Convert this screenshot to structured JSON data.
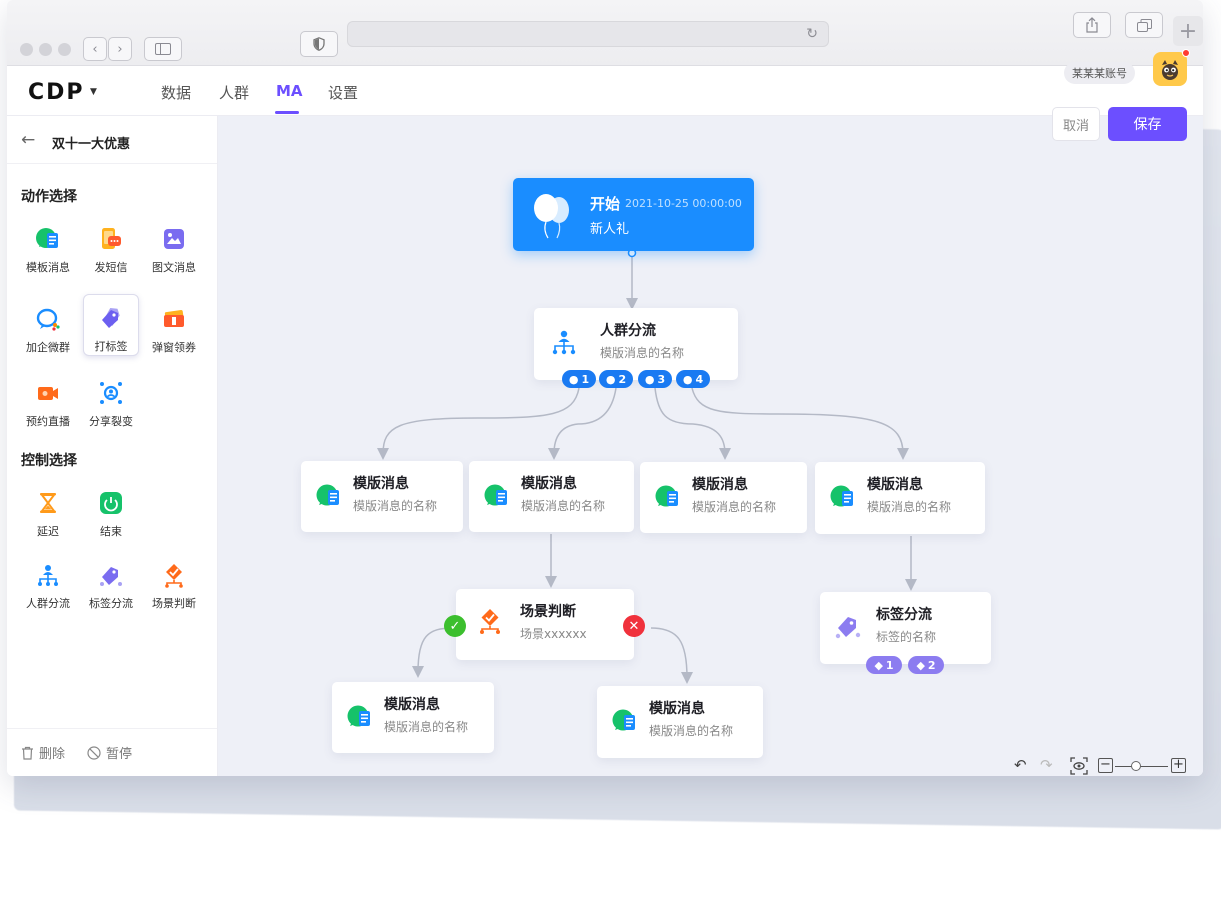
{
  "browser": {
    "url": ""
  },
  "header": {
    "logo": "CDP",
    "tabs": [
      {
        "label": "数据"
      },
      {
        "label": "人群"
      },
      {
        "label": "MA",
        "active": true
      },
      {
        "label": "设置"
      }
    ],
    "account": "某某某账号"
  },
  "actions": {
    "cancel": "取消",
    "save": "保存"
  },
  "sidebar": {
    "back_title": "双十一大优惠",
    "action_section": "动作选择",
    "action_tools": [
      {
        "label": "模板消息",
        "icon": "template-message-icon"
      },
      {
        "label": "发短信",
        "icon": "sms-icon"
      },
      {
        "label": "图文消息",
        "icon": "image-text-icon"
      },
      {
        "label": "加企微群",
        "icon": "wecom-group-icon"
      },
      {
        "label": "打标签",
        "icon": "tag-icon",
        "selected": true
      },
      {
        "label": "弹窗领券",
        "icon": "coupon-icon"
      },
      {
        "label": "预约直播",
        "icon": "live-icon"
      },
      {
        "label": "分享裂变",
        "icon": "share-fission-icon"
      }
    ],
    "control_section": "控制选择",
    "control_tools": [
      {
        "label": "延迟",
        "icon": "hourglass-icon"
      },
      {
        "label": "结束",
        "icon": "power-icon"
      },
      {
        "label": "人群分流",
        "icon": "crowd-split-icon"
      },
      {
        "label": "标签分流",
        "icon": "tag-split-icon"
      },
      {
        "label": "场景判断",
        "icon": "scene-judge-icon"
      }
    ],
    "footer": {
      "delete": "删除",
      "pause": "暂停"
    }
  },
  "flow": {
    "start": {
      "title": "开始",
      "time": "2021-10-25 00:00:00",
      "subtitle": "新人礼"
    },
    "crowd_split": {
      "title": "人群分流",
      "subtitle": "模版消息的名称",
      "branches": [
        "1",
        "2",
        "3",
        "4"
      ]
    },
    "messages": [
      {
        "title": "模版消息",
        "subtitle": "模版消息的名称"
      },
      {
        "title": "模版消息",
        "subtitle": "模版消息的名称"
      },
      {
        "title": "模版消息",
        "subtitle": "模版消息的名称"
      },
      {
        "title": "模版消息",
        "subtitle": "模版消息的名称"
      }
    ],
    "scene_judge": {
      "title": "场景判断",
      "subtitle": "场景xxxxxx"
    },
    "tag_split": {
      "title": "标签分流",
      "subtitle": "标签的名称",
      "branches": [
        "1",
        "2"
      ]
    },
    "yes_message": {
      "title": "模版消息",
      "subtitle": "模版消息的名称"
    },
    "no_message": {
      "title": "模版消息",
      "subtitle": "模版消息的名称"
    }
  },
  "colors": {
    "accent": "#6c4fff",
    "start_node": "#1a8dff",
    "wechat_green": "#16c26a",
    "yes": "#3cbf2e",
    "no": "#f0313c"
  }
}
